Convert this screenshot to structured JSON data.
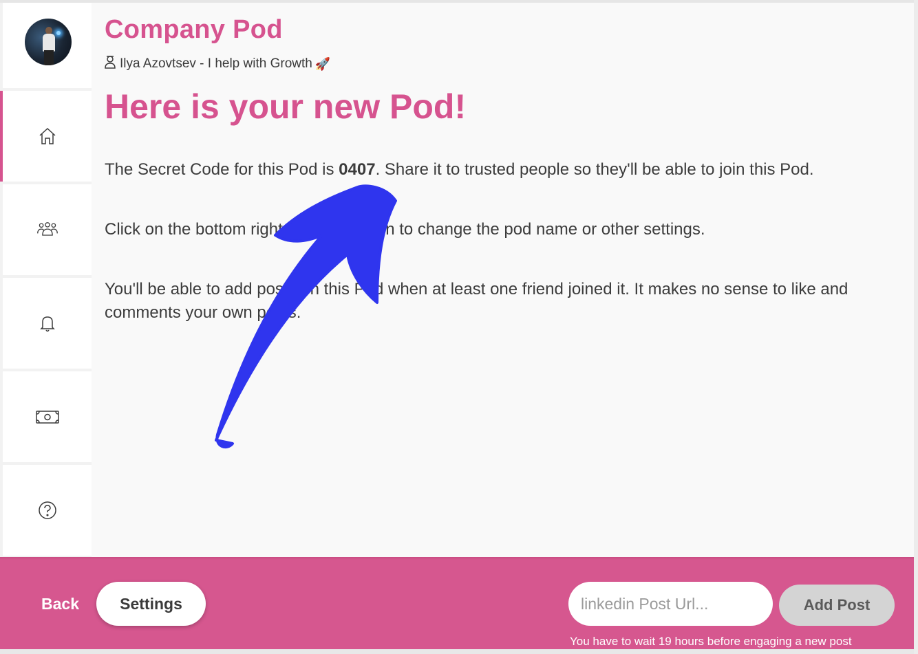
{
  "sidebar": {
    "items": [
      {
        "name": "home",
        "icon": "home-icon",
        "active": true
      },
      {
        "name": "members",
        "icon": "people-icon",
        "active": false
      },
      {
        "name": "notifications",
        "icon": "bell-icon",
        "active": false
      },
      {
        "name": "billing",
        "icon": "money-icon",
        "active": false
      },
      {
        "name": "help",
        "icon": "help-circle-icon",
        "active": false
      }
    ]
  },
  "header": {
    "pod_title": "Company Pod",
    "owner": "Ilya Azovtsev - I help with Growth",
    "owner_emoji": "🚀"
  },
  "main": {
    "headline": "Here is your new Pod!",
    "secret_code_prefix": "The Secret Code for this Pod is ",
    "secret_code": "0407",
    "secret_code_suffix": ". Share it to trusted people so they'll be able to join this Pod.",
    "settings_hint": "Click on the bottom right settings button to change the pod name or other settings.",
    "posting_hint": "You'll be able to add posts on this Pod when at least one friend joined it. It makes no sense to like and comments your own posts."
  },
  "footer": {
    "back_label": "Back",
    "settings_label": "Settings",
    "url_placeholder": "linkedin Post Url...",
    "add_post_label": "Add Post",
    "wait_note": "You have to wait 19 hours before engaging a new post"
  },
  "colors": {
    "accent": "#d6538f",
    "bottom_bar": "#d6578f",
    "annotation_arrow": "#2f35ee"
  }
}
